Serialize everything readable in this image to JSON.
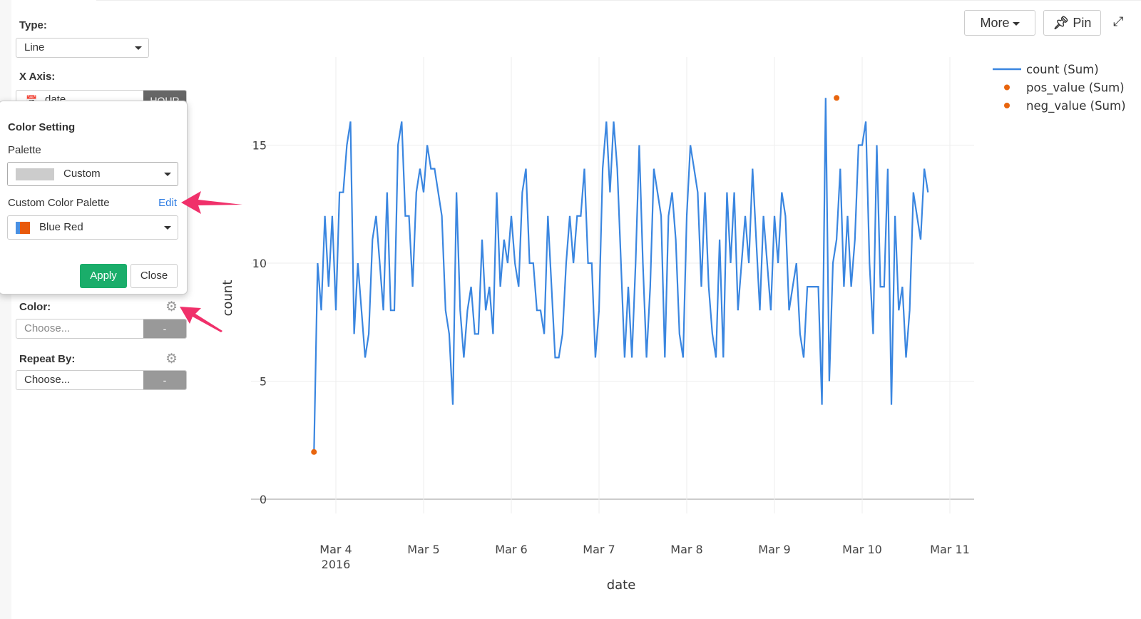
{
  "sidebar": {
    "type_label": "Type:",
    "type_value": "Line",
    "xaxis_label": "X Axis:",
    "xaxis_value": "date",
    "xaxis_unit": "HOUR",
    "color_label": "Color:",
    "color_placeholder": "Choose...",
    "color_button": "-",
    "repeat_label": "Repeat By:",
    "repeat_placeholder": "Choose...",
    "repeat_button": "-"
  },
  "color_setting": {
    "title": "Color Setting",
    "palette_label": "Palette",
    "palette_value": "Custom",
    "custom_palette_label": "Custom Color Palette",
    "edit_link": "Edit",
    "custom_palette_value": "Blue Red",
    "custom_palette_colors": [
      "#4a90e2",
      "#e8590c"
    ],
    "apply_label": "Apply",
    "close_label": "Close"
  },
  "toolbar": {
    "more_label": "More",
    "pin_label": "Pin",
    "pin_icon": "⌶"
  },
  "colors": {
    "line": "#3a86e0",
    "marker": "#e8650e",
    "annotation_arrow": "#f0306a",
    "apply": "#1aad6a"
  },
  "chart_data": {
    "type": "line",
    "xlabel": "date",
    "ylabel": "count",
    "x_start": "2016-03-03 18:00",
    "x_interval": "1 hour",
    "x_tick_labels": [
      "Mar 4",
      "Mar 5",
      "Mar 6",
      "Mar 7",
      "Mar 8",
      "Mar 9",
      "Mar 10",
      "Mar 11"
    ],
    "x_tick_sublabel": "2016",
    "x_range_days": [
      -0.3,
      7.1
    ],
    "y_ticks": [
      0,
      5,
      10,
      15
    ],
    "ylim": [
      0,
      17.5
    ],
    "grid": true,
    "legend_position": "top-right",
    "legend": [
      {
        "name": "count (Sum)",
        "kind": "line"
      },
      {
        "name": "pos_value (Sum)",
        "kind": "marker"
      },
      {
        "name": "neg_value (Sum)",
        "kind": "marker"
      }
    ],
    "series": [
      {
        "name": "count (Sum)",
        "values": [
          2,
          10,
          8,
          12,
          9,
          12,
          8,
          13,
          13,
          15,
          16,
          7,
          10,
          8,
          6,
          7,
          11,
          12,
          10,
          8,
          13,
          8,
          8,
          15,
          16,
          12,
          12,
          9,
          13,
          14,
          13,
          15,
          14,
          14,
          13,
          12,
          8,
          7,
          4,
          13,
          8,
          6,
          8,
          9,
          7,
          7,
          11,
          8,
          9,
          7,
          13,
          9,
          11,
          10,
          12,
          10,
          9,
          13,
          14,
          10,
          10,
          8,
          8,
          7,
          12,
          9,
          6,
          6,
          7,
          10,
          12,
          10,
          12,
          12,
          14,
          10,
          10,
          6,
          8,
          14,
          16,
          13,
          16,
          14,
          10,
          6,
          9,
          6,
          10,
          15,
          10,
          6,
          9,
          14,
          13,
          12,
          6,
          12,
          13,
          11,
          7,
          6,
          12,
          15,
          14,
          13,
          9,
          13,
          9,
          7,
          6,
          11,
          6,
          13,
          10,
          13,
          8,
          10,
          12,
          10,
          14,
          11,
          8,
          12,
          10,
          8,
          12,
          10,
          13,
          12,
          8,
          9,
          10,
          7,
          6,
          9,
          9,
          9,
          9,
          4,
          17,
          5,
          10,
          11,
          14,
          9,
          12,
          9,
          11,
          15,
          15,
          16,
          10,
          7,
          15,
          9,
          9,
          14,
          4,
          12,
          8,
          9,
          6,
          8,
          13,
          12,
          11,
          14,
          13
        ]
      },
      {
        "name": "pos_value (Sum)",
        "points": [
          {
            "index": 0,
            "value": 2
          },
          {
            "index": 143,
            "value": 17
          }
        ]
      },
      {
        "name": "neg_value (Sum)",
        "points": []
      }
    ]
  }
}
